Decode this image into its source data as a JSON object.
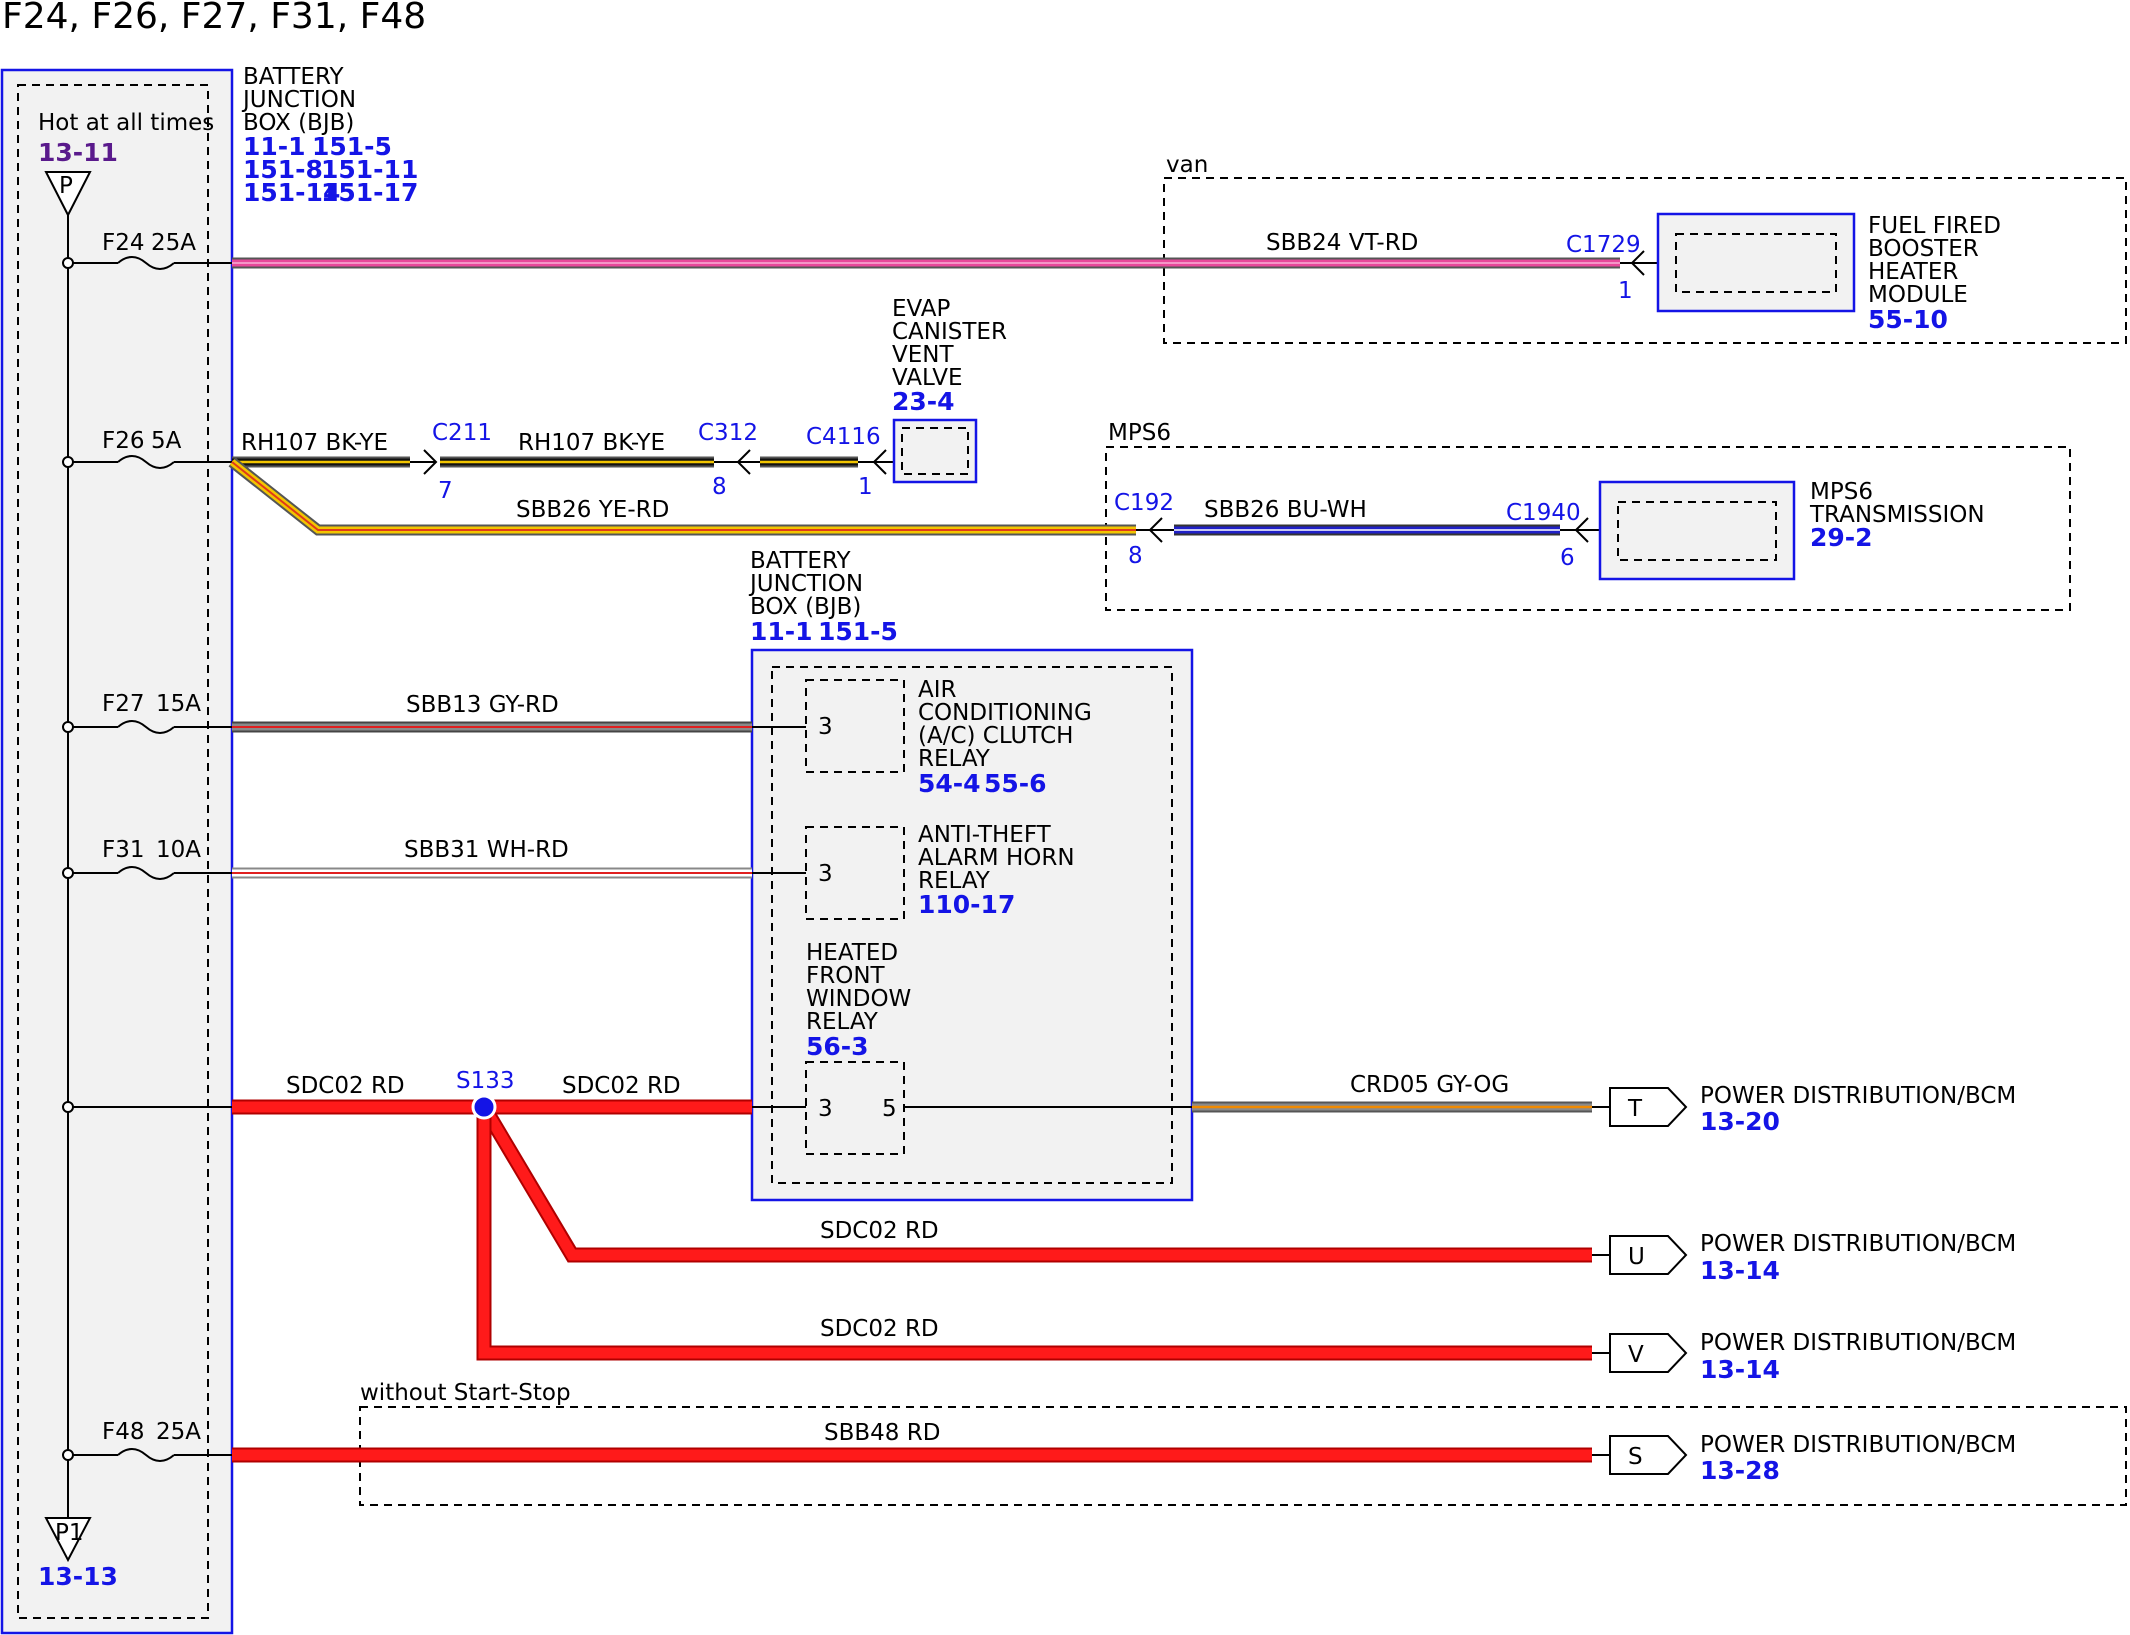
{
  "title": "F24, F26, F27, F31, F48",
  "colors": {
    "component_blue": "#1414e6",
    "wire_red": "#ff1a1a",
    "wire_magenta": "#e8489a",
    "wire_yellow": "#f2c500",
    "wire_blue": "#2020c8",
    "wire_gray": "#808080"
  },
  "bjb_main": {
    "name_lines": [
      "BATTERY",
      "JUNCTION",
      "BOX (BJB)"
    ],
    "refs": [
      "11-1",
      "151-5",
      "151-8",
      "151-11",
      "151-14",
      "151-17"
    ],
    "hot_label": "Hot at all times",
    "hot_ref": "13-11",
    "top_pin": "P",
    "bottom_pin": "P1",
    "bottom_ref": "13-13"
  },
  "fuses": [
    {
      "name": "F24",
      "rating": "25A"
    },
    {
      "name": "F26",
      "rating": "5A"
    },
    {
      "name": "F27",
      "rating": "15A"
    },
    {
      "name": "F31",
      "rating": "10A"
    },
    {
      "name": "F48",
      "rating": "25A"
    }
  ],
  "wires": {
    "sbb24": "SBB24  VT-RD",
    "rh107_a": "RH107  BK-YE",
    "rh107_b": "RH107  BK-YE",
    "sbb26_yerd": "SBB26  YE-RD",
    "sbb26_buwh": "SBB26  BU-WH",
    "sbb13": "SBB13  GY-RD",
    "sbb31": "SBB31  WH-RD",
    "sdc02_a": "SDC02  RD",
    "sdc02_b": "SDC02  RD",
    "sdc02_c": "SDC02  RD",
    "sdc02_d": "SDC02  RD",
    "crd05": "CRD05  GY-OG",
    "sbb48": "SBB48  RD"
  },
  "connectors": {
    "c1729": {
      "name": "C1729",
      "pin": "1"
    },
    "c211": {
      "name": "C211",
      "pin": "7"
    },
    "c312": {
      "name": "C312",
      "pin": "8"
    },
    "c4116": {
      "name": "C4116",
      "pin": "1"
    },
    "c192": {
      "name": "C192",
      "pin": "8"
    },
    "c1940": {
      "name": "C1940",
      "pin": "6"
    }
  },
  "splice": "S133",
  "groups": {
    "van": "van",
    "mps6": "MPS6",
    "without_ss": "without Start-Stop"
  },
  "components": {
    "fuel_heater": {
      "lines": [
        "FUEL FIRED",
        "BOOSTER",
        "HEATER",
        "MODULE"
      ],
      "ref": "55-10"
    },
    "evap": {
      "lines": [
        "EVAP",
        "CANISTER",
        "VENT",
        "VALVE"
      ],
      "ref": "23-4"
    },
    "mps6_trans": {
      "lines": [
        "MPS6",
        "TRANSMISSION"
      ],
      "ref": "29-2"
    }
  },
  "bjb_relays": {
    "name_lines": [
      "BATTERY",
      "JUNCTION",
      "BOX (BJB)"
    ],
    "refs": [
      "11-1",
      "151-5"
    ],
    "ac_relay": {
      "lines": [
        "AIR",
        "CONDITIONING",
        "(A/C) CLUTCH",
        "RELAY"
      ],
      "refs": [
        "54-4",
        "55-6"
      ],
      "pin": "3"
    },
    "horn_relay": {
      "lines": [
        "ANTI-THEFT",
        "ALARM HORN",
        "RELAY"
      ],
      "ref": "110-17",
      "pin": "3"
    },
    "window_relay": {
      "lines": [
        "HEATED",
        "FRONT",
        "WINDOW",
        "RELAY"
      ],
      "ref": "56-3",
      "pin_in": "3",
      "pin_out": "5"
    }
  },
  "destinations": [
    {
      "letter": "T",
      "label": "POWER DISTRIBUTION/BCM",
      "ref": "13-20"
    },
    {
      "letter": "U",
      "label": "POWER DISTRIBUTION/BCM",
      "ref": "13-14"
    },
    {
      "letter": "V",
      "label": "POWER DISTRIBUTION/BCM",
      "ref": "13-14"
    },
    {
      "letter": "S",
      "label": "POWER DISTRIBUTION/BCM",
      "ref": "13-28"
    }
  ]
}
